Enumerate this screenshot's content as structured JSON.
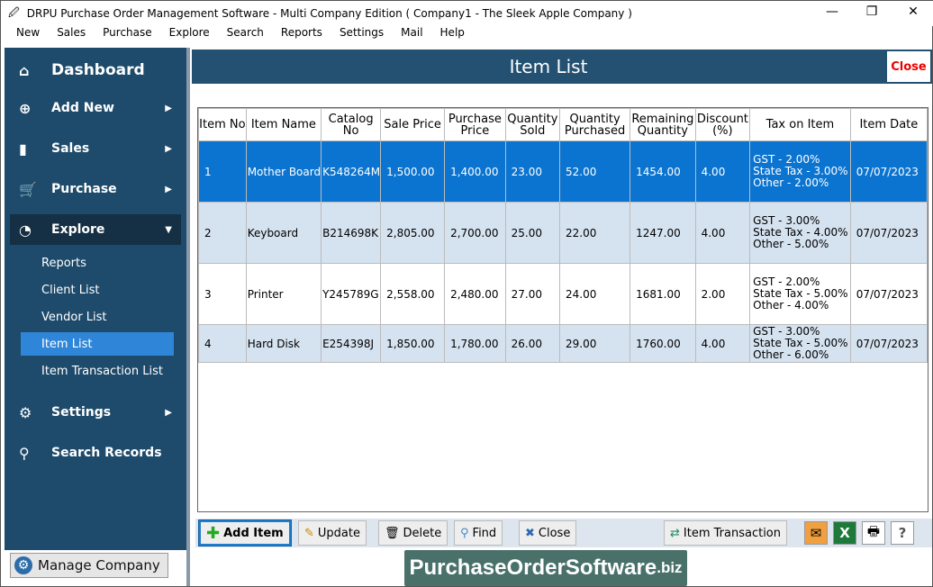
{
  "window": {
    "title": "DRPU Purchase Order Management Software - Multi Company Edition ( Company1 - The Sleek Apple Company )"
  },
  "menu": [
    "New",
    "Sales",
    "Purchase",
    "Explore",
    "Search",
    "Reports",
    "Settings",
    "Mail",
    "Help"
  ],
  "sidebar": {
    "dashboard": "Dashboard",
    "add_new": "Add New",
    "sales": "Sales",
    "purchase": "Purchase",
    "explore": "Explore",
    "sub": [
      "Reports",
      "Client List",
      "Vendor List",
      "Item List",
      "Item Transaction List"
    ],
    "settings": "Settings",
    "search": "Search Records",
    "manage": "Manage Company"
  },
  "main": {
    "title": "Item List",
    "close": "Close"
  },
  "table": {
    "headers": [
      "Item No",
      "Item Name",
      "Catalog No",
      "Sale Price",
      "Purchase Price",
      "Quantity Sold",
      "Quantity Purchased",
      "Remaining Quantity",
      "Discount (%)",
      "Tax on Item",
      "Item Date"
    ],
    "rows": [
      [
        "1",
        "Mother Board",
        "K548264M",
        "1,500.00",
        "1,400.00",
        "23.00",
        "52.00",
        "1454.00",
        "4.00",
        [
          "GST - 2.00%",
          "State Tax - 3.00%",
          "Other - 2.00%"
        ],
        "07/07/2023"
      ],
      [
        "2",
        "Keyboard",
        "B214698K",
        "2,805.00",
        "2,700.00",
        "25.00",
        "22.00",
        "1247.00",
        "4.00",
        [
          "GST - 3.00%",
          "State Tax - 4.00%",
          "Other - 5.00%"
        ],
        "07/07/2023"
      ],
      [
        "3",
        "Printer",
        "Y245789G",
        "2,558.00",
        "2,480.00",
        "27.00",
        "24.00",
        "1681.00",
        "2.00",
        [
          "GST - 2.00%",
          "State Tax - 5.00%",
          "Other - 4.00%"
        ],
        "07/07/2023"
      ],
      [
        "4",
        "Hard Disk",
        "E254398J",
        "1,850.00",
        "1,780.00",
        "26.00",
        "29.00",
        "1760.00",
        "4.00",
        [
          "GST - 3.00%",
          "State Tax - 5.00%",
          "Other - 6.00%"
        ],
        "07/07/2023"
      ]
    ],
    "selected_row": 0
  },
  "toolbar": {
    "add": "Add Item",
    "update": "Update",
    "delete": "Delete",
    "find": "Find",
    "close": "Close",
    "transaction": "Item Transaction"
  },
  "logo": {
    "main": "PurchaseOrderSoftware",
    "suffix": ".biz"
  }
}
